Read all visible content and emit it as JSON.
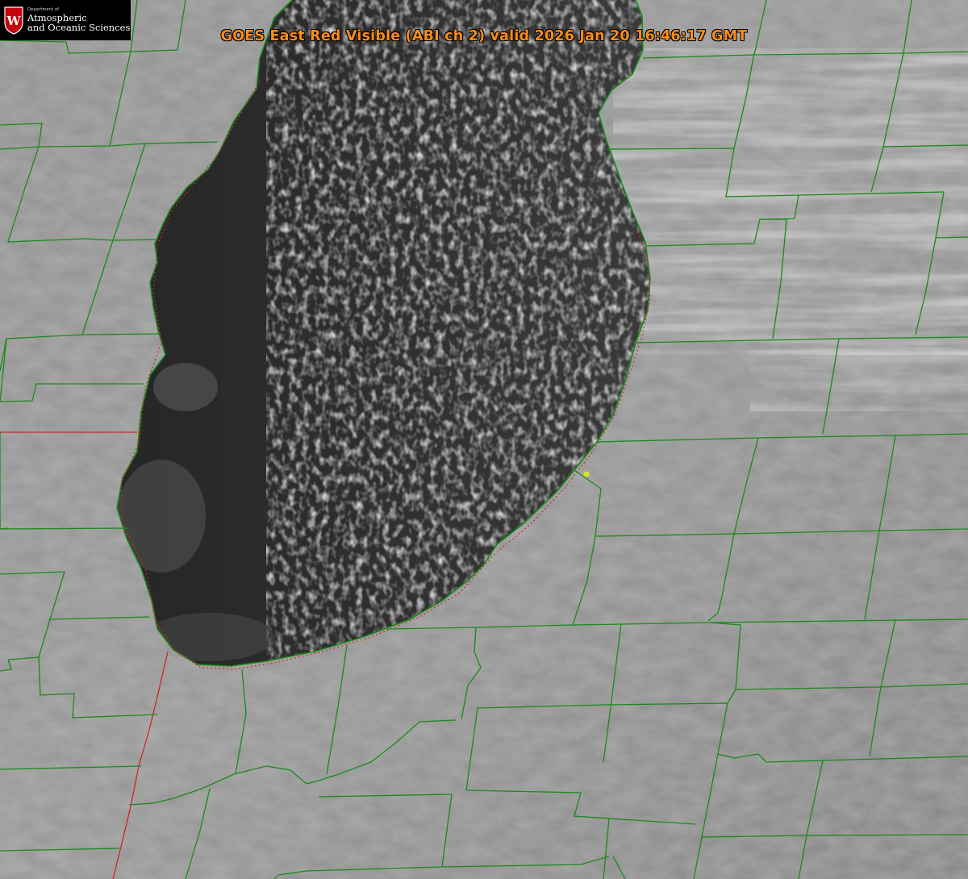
{
  "title": "GOES East Red Visible (ABI ch 2) valid 2026 Jan 20 16:46:17 GMT",
  "logo": {
    "line1": "Department of",
    "line2": "Atmospheric",
    "line3": "and Oceanic Sciences",
    "shield_letter": "W",
    "colors": {
      "shield": "#c5050c",
      "background": "#000000"
    }
  },
  "map": {
    "features": [
      "lake",
      "lake-effect-cloud-streets",
      "lake-shoreline",
      "county-borders",
      "state-border",
      "location-marker"
    ],
    "colors": {
      "county_border": "#1a8a1a",
      "state_border": "#d2232a",
      "shoreline": "#cc3333",
      "lake_water": "#2b2b2b",
      "land": "#8c8c8c",
      "marker": "#e0e020"
    }
  }
}
